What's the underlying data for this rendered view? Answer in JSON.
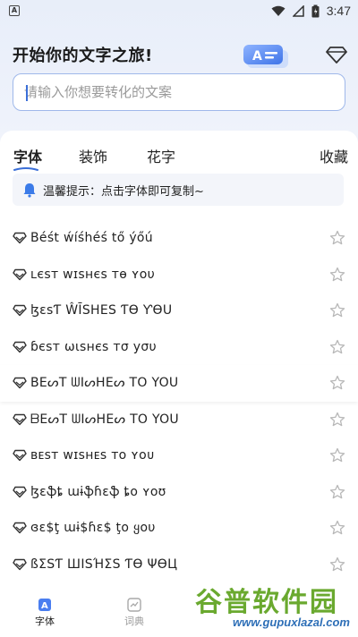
{
  "status_bar": {
    "app_icon_letter": "A",
    "time": "3:47",
    "icons": [
      "wifi-icon",
      "signal-icon",
      "battery-icon"
    ]
  },
  "header": {
    "title": "开始你的文字之旅!",
    "art_letter": "A"
  },
  "search": {
    "placeholder": "请输入你想要转化的文案",
    "value": ""
  },
  "tabs": [
    {
      "label": "字体",
      "active": true
    },
    {
      "label": "装饰",
      "active": false
    },
    {
      "label": "花字",
      "active": false
    },
    {
      "label": "收藏",
      "active": false
    }
  ],
  "notice": {
    "text": "温馨提示：点击字体即可复制~"
  },
  "font_list": [
    "Béśt ẃíśhéś tő ýőú",
    "ʟєsᴛ ᴡɪsнєs ᴛɵ ʏoυ",
    "ɮɛsƬ ŴĪSHES ƬӨ ƳӨU",
    "ɓєѕт ωιѕнєѕ тσ уσυ",
    "BEᔕT ᗯIᔕHEᔕ TO YOU",
    "ᗷEᔕT ᗯIᔕᕼEᔕ TO YOᑌ",
    "ʙᴇsᴛ ᴡɪsʜᴇs ᴛᴏ ʏᴏᴜ",
    "ɮɛֆȶ աɨֆɦɛֆ ȶօ ʏօʊ",
    "ɞɛ$ţ աɨ$ɦɛ$ ţօ ყօυ",
    "ßΣSƬ ШISΉΣS ƬӨ ΨӨЦ"
  ],
  "bottom_nav": [
    {
      "label": "字体",
      "active": true
    },
    {
      "label": "词典",
      "active": false
    }
  ],
  "watermark": {
    "big": "谷普软件园",
    "small": "www.gupuxlazal.com"
  },
  "colors": {
    "accent": "#3b6fd8",
    "search_border": "#9fb8ea",
    "star": "#b8b8b8",
    "watermark_green": "#6aa92f",
    "watermark_blue": "#2e6fb7"
  }
}
